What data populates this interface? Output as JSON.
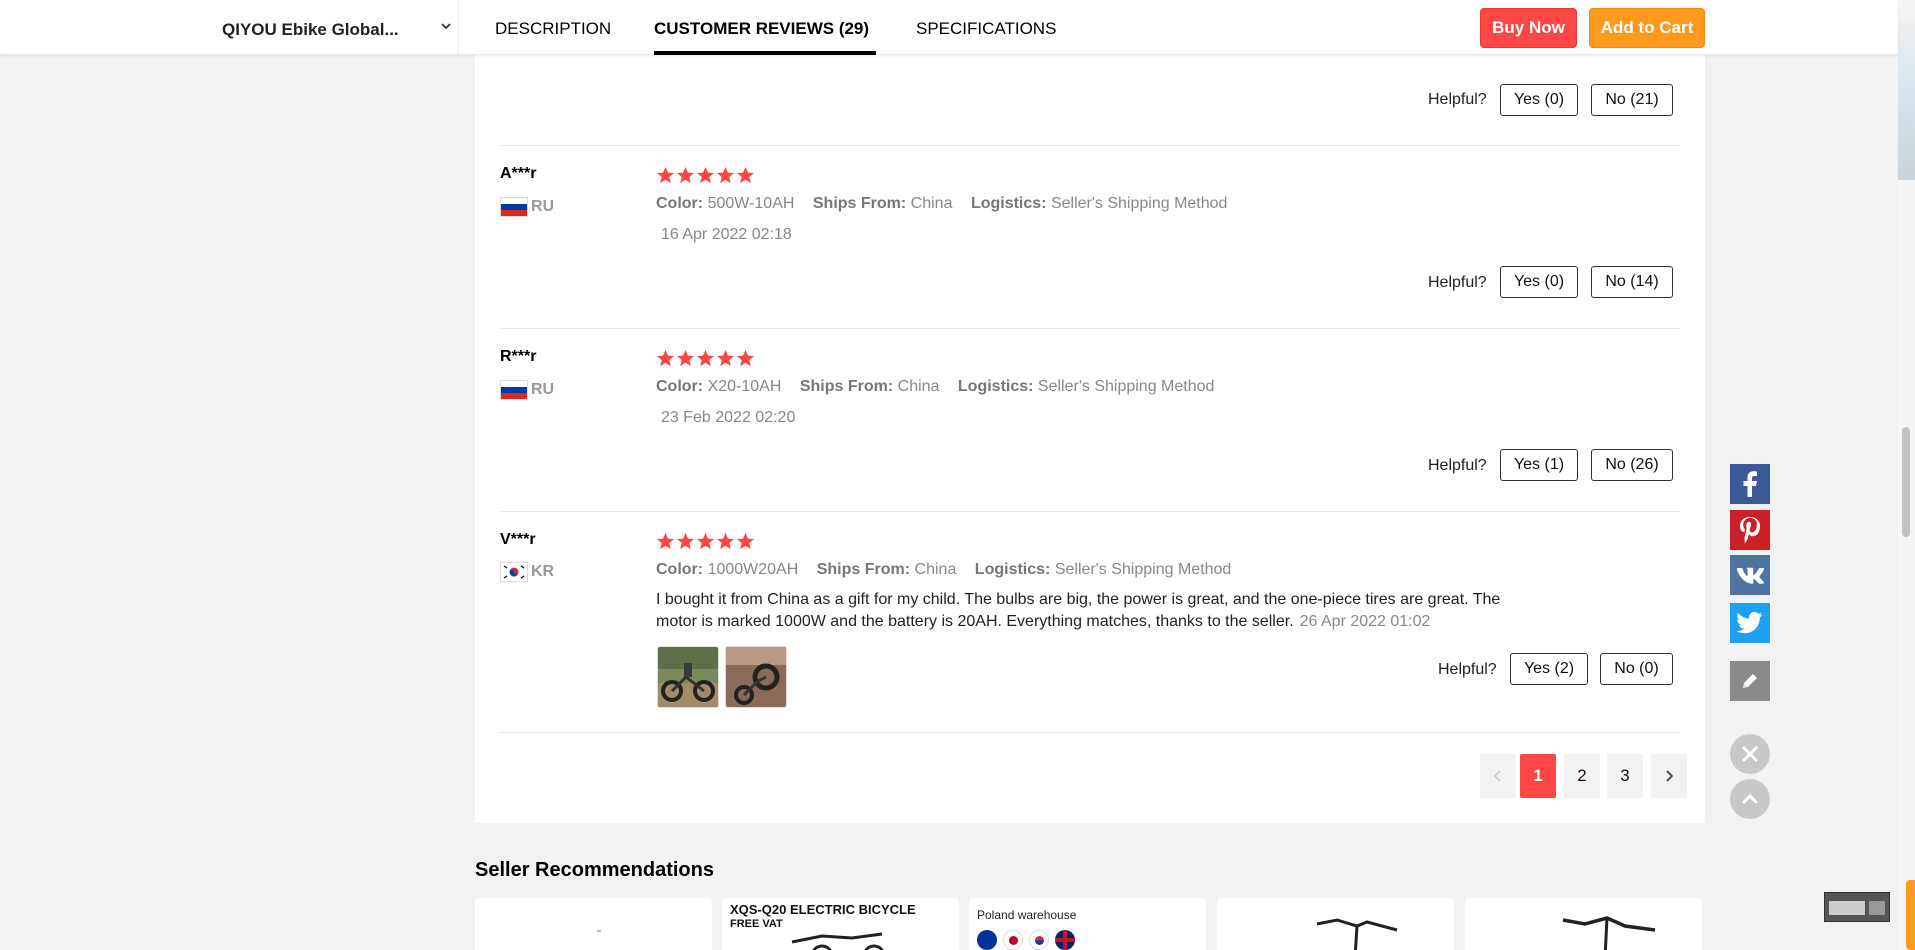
{
  "header": {
    "store_name": "QIYOU Ebike Global...",
    "tabs": [
      "DESCRIPTION",
      "CUSTOMER REVIEWS (29)",
      "SPECIFICATIONS"
    ],
    "active_tab_index": 1,
    "buy_now": "Buy Now",
    "add_to_cart": "Add to Cart"
  },
  "top_partial": {
    "helpful_label": "Helpful?",
    "yes": "Yes (0)",
    "no": "No (21)"
  },
  "reviews": [
    {
      "user": "A***r",
      "country": "RU",
      "stars": 5,
      "color_label": "Color:",
      "color": "500W-10AH",
      "ships_label": "Ships From:",
      "ships": "China",
      "logistics_label": "Logistics:",
      "logistics": "Seller's Shipping Method",
      "date": "16 Apr 2022 02:18",
      "helpful_label": "Helpful?",
      "yes": "Yes (0)",
      "no": "No (14)"
    },
    {
      "user": "R***r",
      "country": "RU",
      "stars": 5,
      "color_label": "Color:",
      "color": "X20-10AH",
      "ships_label": "Ships From:",
      "ships": "China",
      "logistics_label": "Logistics:",
      "logistics": "Seller's Shipping Method",
      "date": "23 Feb 2022 02:20",
      "helpful_label": "Helpful?",
      "yes": "Yes (1)",
      "no": "No (26)"
    },
    {
      "user": "V***r",
      "country": "KR",
      "stars": 5,
      "color_label": "Color:",
      "color": "1000W20AH",
      "ships_label": "Ships From:",
      "ships": "China",
      "logistics_label": "Logistics:",
      "logistics": "Seller's Shipping Method",
      "text": "I bought it from China as a gift for my child. The bulbs are big, the power is great, and the one-piece tires are great. The motor is marked 1000W and the battery is 20AH. Everything matches, thanks to the seller.",
      "date": "26 Apr 2022 01:02",
      "helpful_label": "Helpful?",
      "yes": "Yes (2)",
      "no": "No (0)"
    }
  ],
  "pagination": {
    "pages": [
      "1",
      "2",
      "3"
    ],
    "active": "1",
    "prev_icon": "chevron-left-icon",
    "next_icon": "chevron-right-icon"
  },
  "seller_recommendations": {
    "title": "Seller Recommendations",
    "items": [
      {
        "text": ""
      },
      {
        "text": "XQS-Q20 ELECTRIC BICYCLE",
        "subtext": "FREE VAT"
      },
      {
        "text": "Poland warehouse"
      },
      {
        "text": ""
      },
      {
        "text": ""
      }
    ]
  },
  "share": [
    "facebook-icon",
    "pinterest-icon",
    "vk-icon",
    "twitter-icon"
  ],
  "colors": {
    "accent_red": "#ff4747",
    "accent_orange": "#ff9a1f",
    "star": "#ff4747"
  }
}
